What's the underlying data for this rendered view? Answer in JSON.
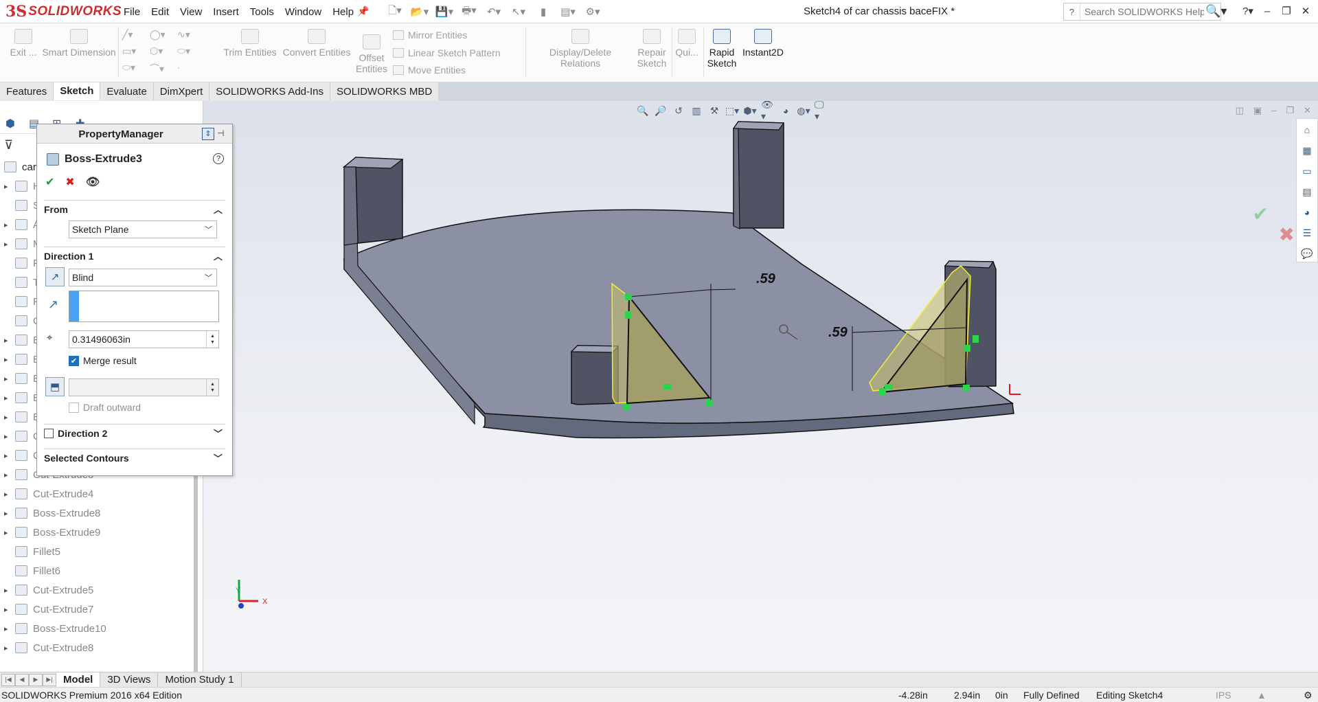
{
  "app": {
    "brand": "SOLIDWORKS",
    "window_title": "Sketch4 of car chassis baceFIX *",
    "search_placeholder": "Search SOLIDWORKS Help",
    "accent_red": "#d12a2f"
  },
  "menu": [
    "File",
    "Edit",
    "View",
    "Insert",
    "Tools",
    "Window",
    "Help"
  ],
  "ribbon": {
    "exit_sketch": "Exit ...",
    "smart_dimension": "Smart Dimension",
    "trim_entities": "Trim Entities",
    "convert_entities": "Convert Entities",
    "offset_entities": "Offset\nEntities",
    "mirror_entities": "Mirror Entities",
    "linear_sketch_pattern": "Linear Sketch Pattern",
    "move_entities": "Move Entities",
    "display_delete_relations": "Display/Delete Relations",
    "repair_sketch": "Repair\nSketch",
    "quick_snaps": "Qui...",
    "rapid_sketch": "Rapid\nSketch",
    "instant2d": "Instant2D"
  },
  "tabs": [
    "Features",
    "Sketch",
    "Evaluate",
    "DimXpert",
    "SOLIDWORKS Add-Ins",
    "SOLIDWORKS MBD"
  ],
  "active_tab": "Sketch",
  "tree": {
    "root": "car c",
    "items": [
      {
        "label": "H"
      },
      {
        "label": "S"
      },
      {
        "label": "A"
      },
      {
        "label": "M"
      },
      {
        "label": "F"
      },
      {
        "label": "T"
      },
      {
        "label": "R"
      },
      {
        "label": "C"
      },
      {
        "label": "B"
      },
      {
        "label": "B"
      },
      {
        "label": "B"
      },
      {
        "label": "B"
      },
      {
        "label": "B"
      },
      {
        "label": "C"
      },
      {
        "label": "C"
      },
      {
        "label": "Cut-Extrude3"
      },
      {
        "label": "Cut-Extrude4"
      },
      {
        "label": "Boss-Extrude8"
      },
      {
        "label": "Boss-Extrude9"
      },
      {
        "label": "Fillet5"
      },
      {
        "label": "Fillet6"
      },
      {
        "label": "Cut-Extrude5"
      },
      {
        "label": "Cut-Extrude7"
      },
      {
        "label": "Boss-Extrude10"
      },
      {
        "label": "Cut-Extrude8"
      }
    ]
  },
  "property_manager": {
    "header": "PropertyManager",
    "feature_name": "Boss-Extrude3",
    "from_label": "From",
    "from_value": "Sketch Plane",
    "direction1_label": "Direction 1",
    "end_condition": "Blind",
    "depth": "0.31496063in",
    "merge_result": "Merge result",
    "merge_checked": true,
    "draft_outward": "Draft outward",
    "direction2_label": "Direction 2",
    "selected_contours": "Selected Contours"
  },
  "viewport": {
    "dimension_left": ".59",
    "dimension_right": ".59",
    "triad_y": "Y",
    "triad_x": "X"
  },
  "bottom_tabs": [
    "Model",
    "3D Views",
    "Motion Study 1"
  ],
  "active_bottom_tab": "Model",
  "status": {
    "edition": "SOLIDWORKS Premium 2016 x64 Edition",
    "x": "-4.28in",
    "y": "2.94in",
    "z": "0in",
    "state": "Fully Defined",
    "editing": "Editing Sketch4",
    "units": "IPS"
  }
}
